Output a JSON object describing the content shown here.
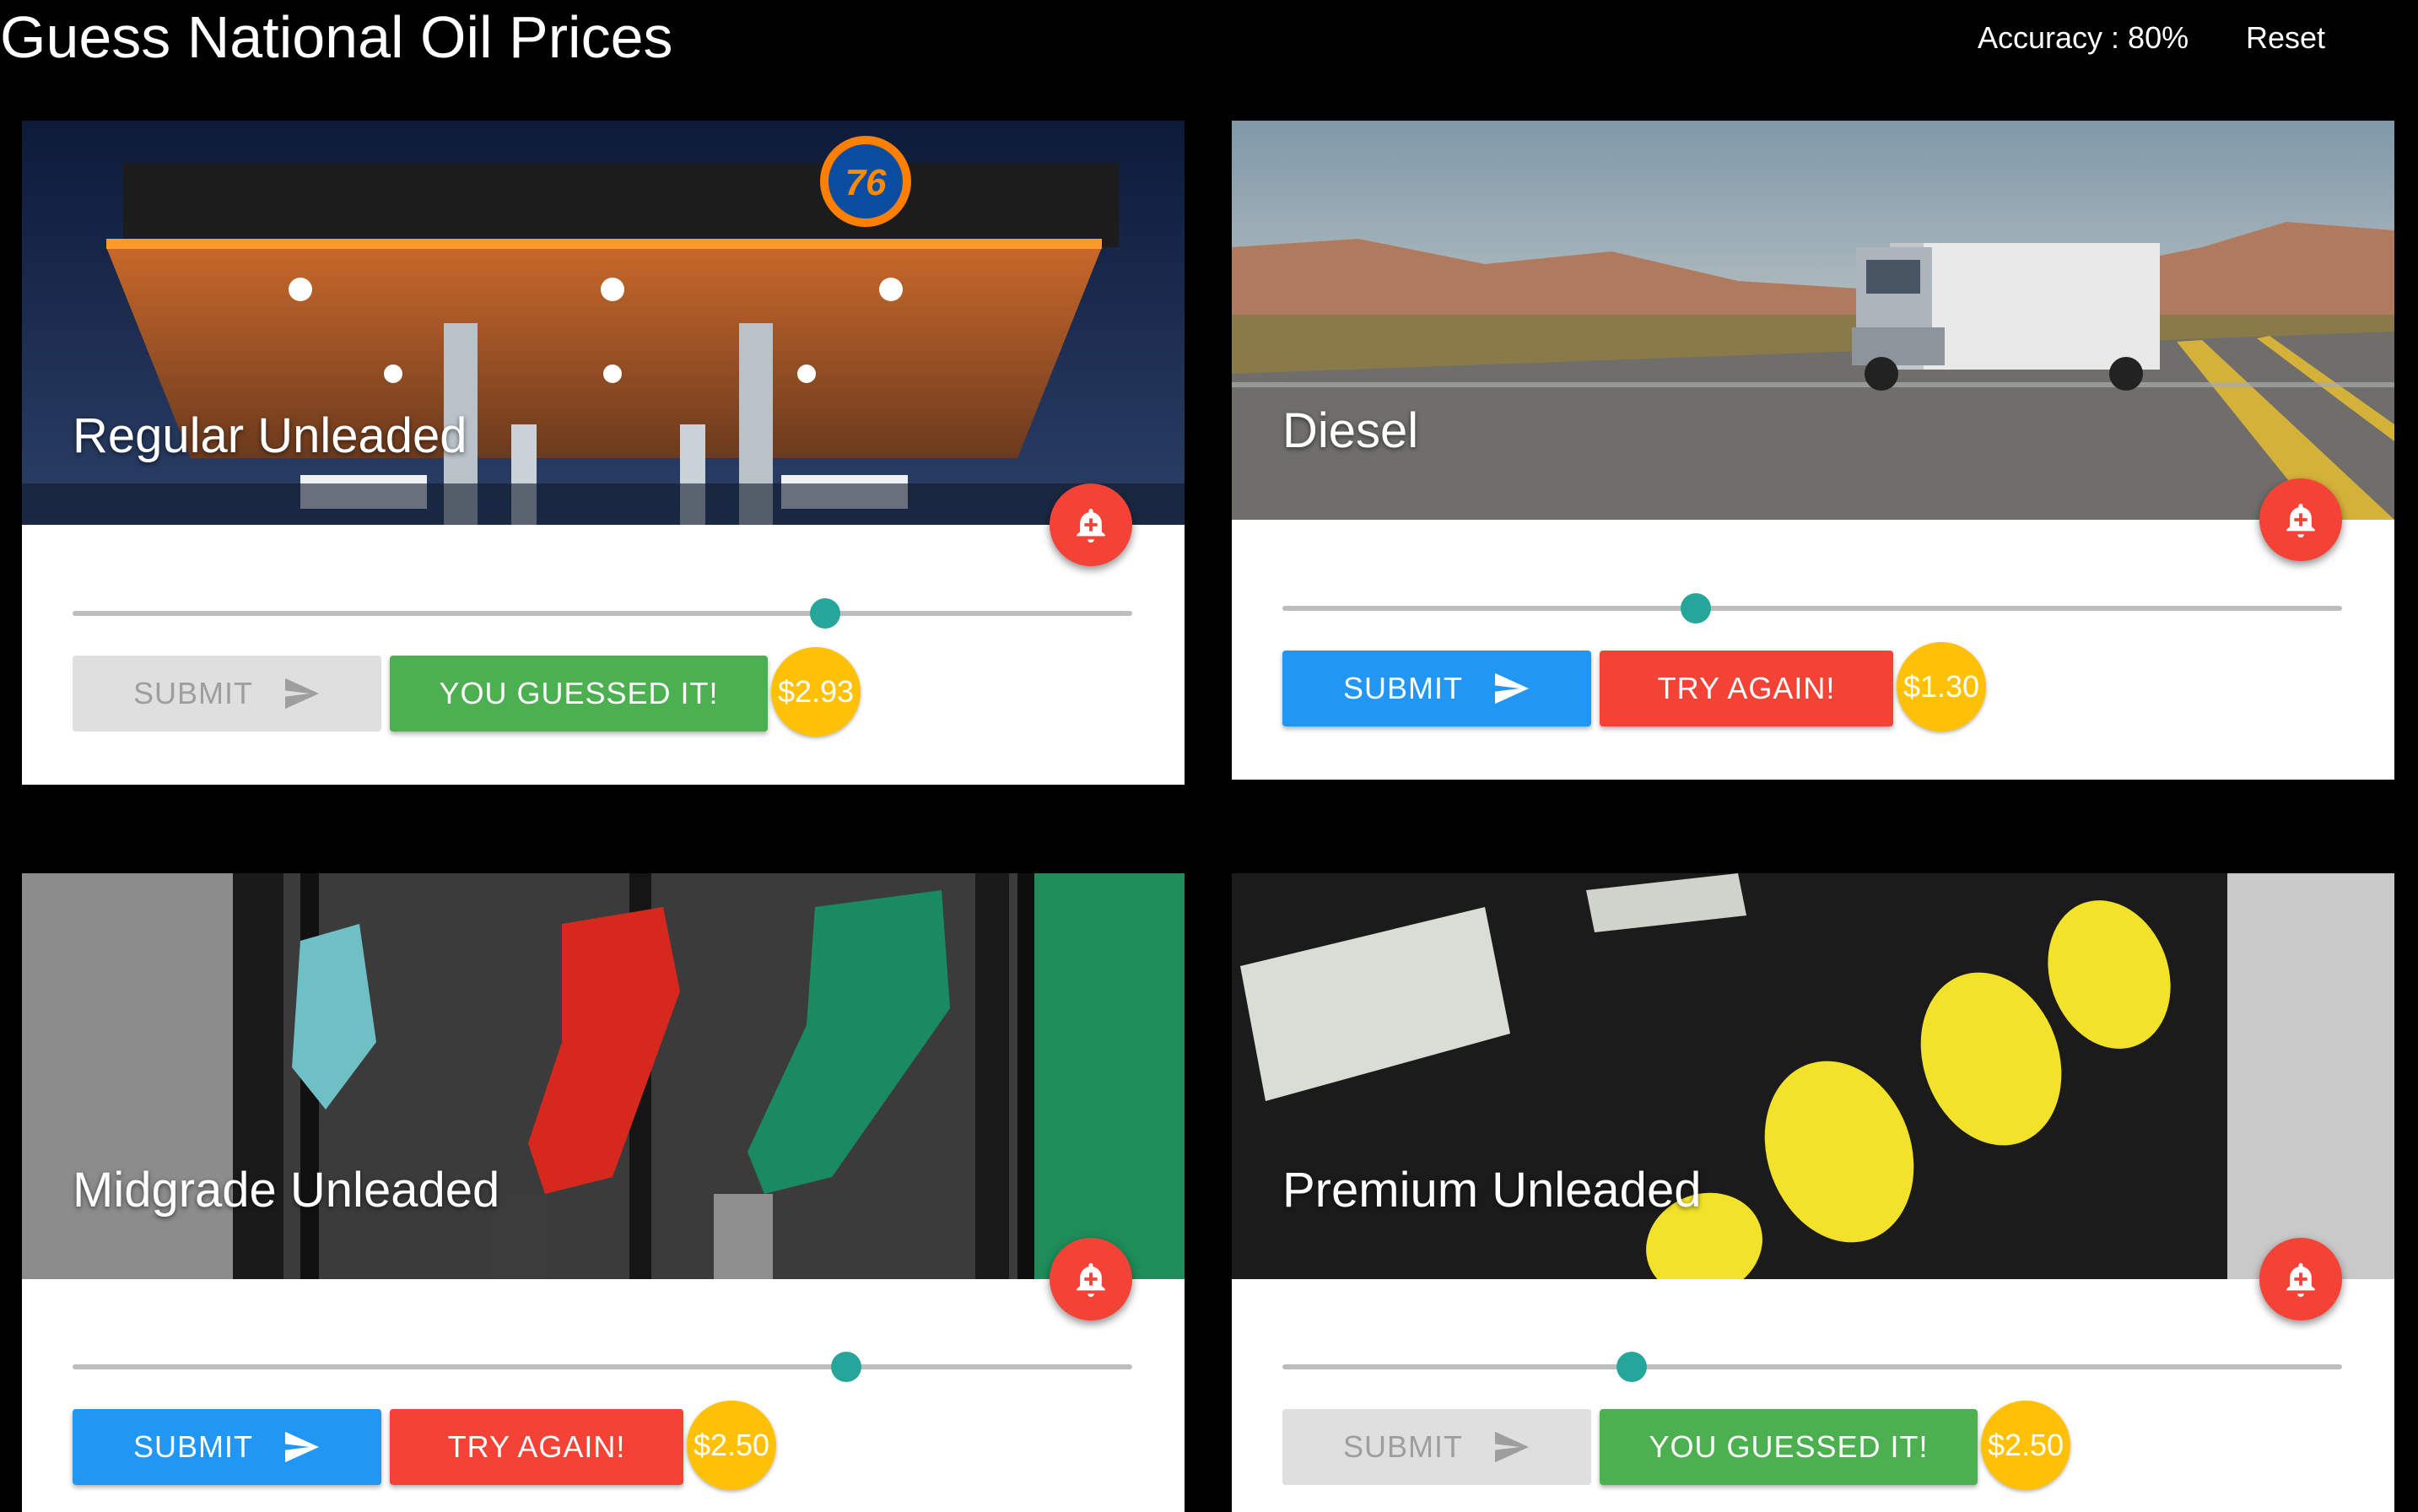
{
  "header": {
    "title": "Guess National Oil Prices",
    "accuracy": "Accuracy : 80%",
    "reset_label": "Reset"
  },
  "theme": {
    "submit_color": "#2196f3",
    "success_color": "#4caf50",
    "error_color": "#f44336",
    "slider_thumb_color": "#26a69a",
    "price_badge_color": "#ffc107",
    "fab_color": "#f44336"
  },
  "cards": [
    {
      "title": "Regular Unleaded",
      "image": "gas-station-76-canopy-image",
      "slider_level_percent": 71,
      "submit_label": "SUBMIT",
      "submit_disabled": true,
      "result_label": "YOU GUESSED IT!",
      "result_status": "correct",
      "price": "$2.93",
      "fab_icon": "add-alert-icon"
    },
    {
      "title": "Diesel",
      "image": "semi-truck-highway-image",
      "slider_level_percent": 39,
      "submit_label": "SUBMIT",
      "submit_disabled": false,
      "result_label": "TRY AGAIN!",
      "result_status": "wrong",
      "price": "$1.30",
      "fab_icon": "add-alert-icon"
    },
    {
      "title": "Midgrade Unleaded",
      "image": "fuel-pump-nozzles-image",
      "slider_level_percent": 73,
      "submit_label": "SUBMIT",
      "submit_disabled": false,
      "result_label": "TRY AGAIN!",
      "result_status": "wrong",
      "price": "$2.50",
      "fab_icon": "add-alert-icon"
    },
    {
      "title": "Premium Unleaded",
      "image": "pump-grade-buttons-image",
      "slider_level_percent": 33,
      "submit_label": "SUBMIT",
      "submit_disabled": true,
      "result_label": "YOU GUESSED IT!",
      "result_status": "correct",
      "price": "$2.50",
      "fab_icon": "add-alert-icon"
    }
  ]
}
